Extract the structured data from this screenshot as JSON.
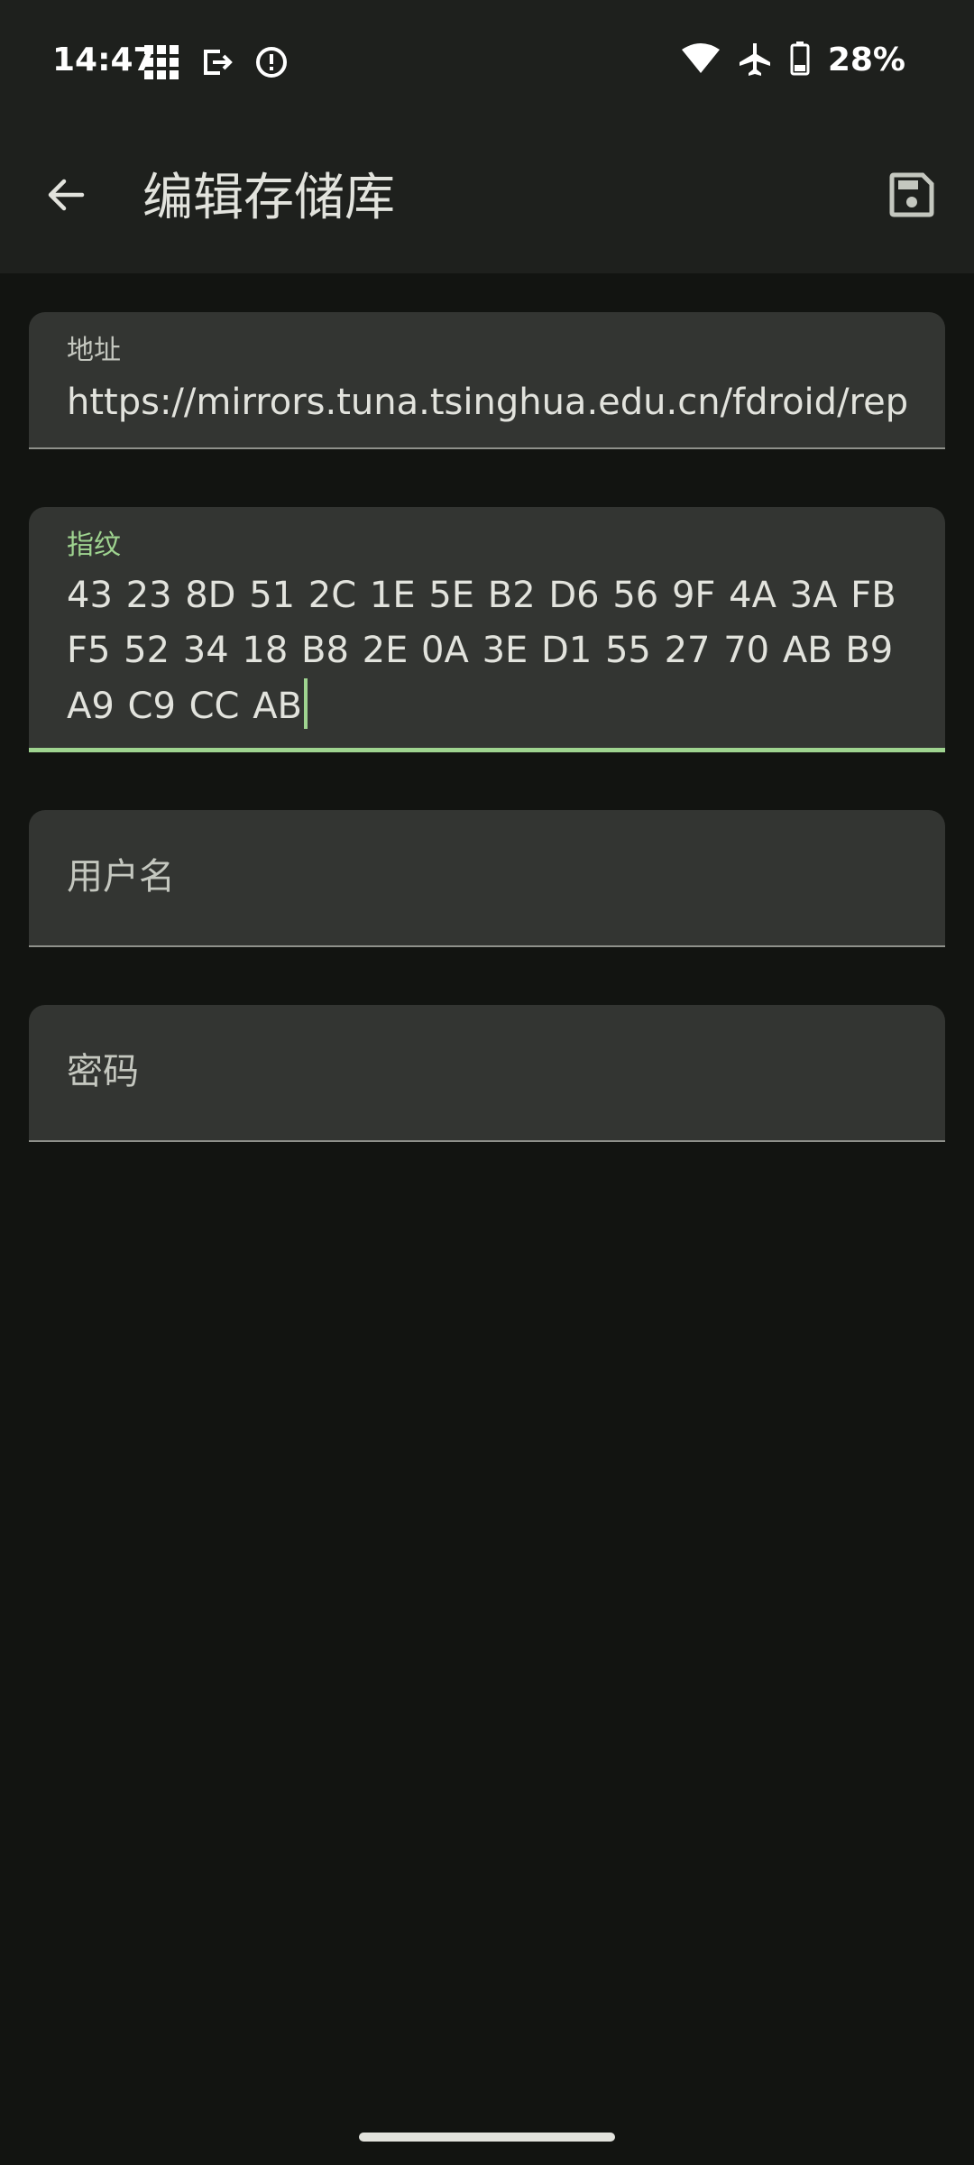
{
  "status_bar": {
    "time": "14:47",
    "battery": "28%",
    "icons": [
      "grid-icon",
      "exit-icon",
      "alert-icon",
      "wifi-icon",
      "airplane-icon",
      "battery-icon"
    ]
  },
  "app_bar": {
    "title": "编辑存储库",
    "back_icon": "arrow-left-icon",
    "save_icon": "save-icon"
  },
  "form": {
    "address": {
      "label": "地址",
      "value": "https://mirrors.tuna.tsinghua.edu.cn/fdroid/rep"
    },
    "fingerprint": {
      "label": "指纹",
      "value": "43 23 8D 51 2C 1E 5E B2 D6 56 9F 4A 3A FB F5 52 34 18 B8 2E 0A 3E D1 55 27 70 AB B9 A9 C9 CC AB"
    },
    "username": {
      "placeholder": "用户名"
    },
    "password": {
      "placeholder": "密码"
    }
  },
  "colors": {
    "background": "#121411",
    "surface": "#1e201d",
    "field": "#333532",
    "accent": "#9fd490"
  }
}
